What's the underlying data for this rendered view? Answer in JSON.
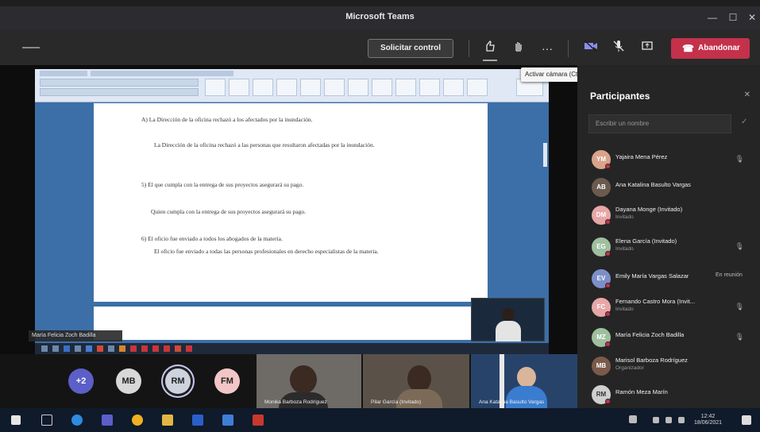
{
  "window": {
    "title": "Microsoft Teams",
    "min_glyph": "—",
    "max_glyph": "☐",
    "close_glyph": "✕"
  },
  "toolbar": {
    "request_control": "Solicitar control",
    "more_glyph": "···",
    "leave_label": "Abandonar",
    "tooltip": "Activar cámara (Ctrl + Mayús + O)"
  },
  "shared_screen": {
    "presenter_tag": "María Felicia Zoch Badilla",
    "doc_lines": [
      "A)  La Dirección de la oficina rechazó a los afectados por la inundación.",
      "La Dirección de la oficina rechazó a las personas que resultaron afectadas por la inundación.",
      "5)  El que cumpla con la entrega de sus proyectos asegurará su pago.",
      "Quien cumpla con la entrega de sus proyectos asegurará su pago.",
      "6)  El oficio fue enviado a todos los abogados de la materia.",
      "El oficio fue enviado a todas las personas profesionales en derecho especialistas de la materia."
    ]
  },
  "participants": {
    "title": "Participantes",
    "search_placeholder": "Escribir un nombre",
    "list": [
      {
        "initials": "YM",
        "name": "Yajaira Mena Pérez",
        "role": "",
        "color": "#d9a38a",
        "note": ""
      },
      {
        "initials": "AB",
        "name": "Ana Katalina Basulto Vargas",
        "role": "",
        "color": "#6b5a4e",
        "note": ""
      },
      {
        "initials": "DM",
        "name": "Dayana Monge (Invitado)",
        "role": "Invitado",
        "color": "#e7a7a7",
        "note": ""
      },
      {
        "initials": "EG",
        "name": "Elena García (Invitado)",
        "role": "Invitado",
        "color": "#9fbf9f",
        "note": ""
      },
      {
        "initials": "EV",
        "name": "Emily María Vargas Salazar",
        "role": "",
        "color": "#7d8fc9",
        "note": "En reunión"
      },
      {
        "initials": "FC",
        "name": "Fernando Castro Mora (Invit...",
        "role": "Invitado",
        "color": "#e7a7a7",
        "note": ""
      },
      {
        "initials": "MZ",
        "name": "María Felicia Zoch Badilla",
        "role": "",
        "color": "#9fbf9f",
        "note": ""
      },
      {
        "initials": "MB",
        "name": "Marisol Barboza Rodríguez",
        "role": "Organizador",
        "color": "#7a5a4a",
        "note": ""
      },
      {
        "initials": "RM",
        "name": "Ramón Meza Marín",
        "role": "",
        "color": "#cfcfcf",
        "note": ""
      }
    ]
  },
  "bottom": {
    "overflow": "+2",
    "avatars": [
      "MB",
      "RM",
      "FM"
    ],
    "videos": [
      "Monika Barboza Rodríguez",
      "Pilar García (Invitado)",
      "Ana Katalina Basulto Vargas"
    ]
  },
  "taskbar": {
    "time": "12:42",
    "date": "18/06/2021"
  }
}
